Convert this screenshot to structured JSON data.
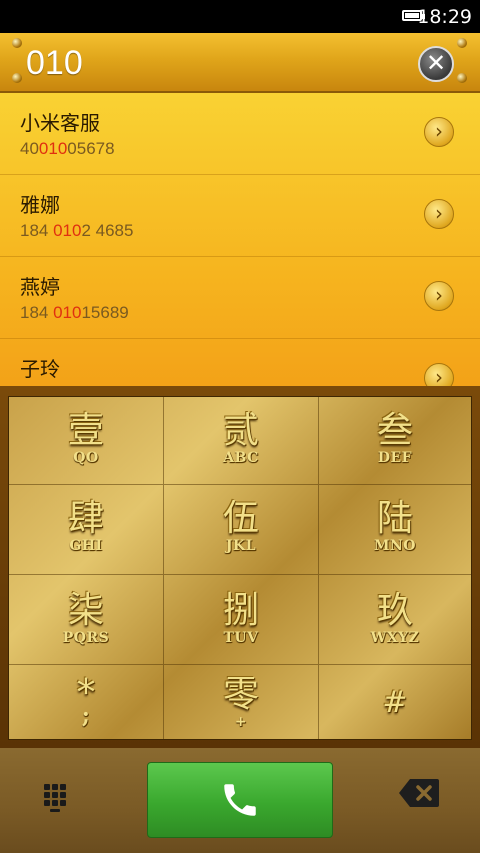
{
  "status_bar": {
    "time": "18:29",
    "battery_icon": "battery-icon"
  },
  "dial_input": {
    "digits": "010",
    "clear_icon": "clear-icon"
  },
  "contacts": [
    {
      "name": "小米客服",
      "number_pre": "40",
      "number_match": "010",
      "number_post": "05678"
    },
    {
      "name": "雅娜",
      "number_pre": "184 ",
      "number_match": "010",
      "number_post": "2 4685"
    },
    {
      "name": "燕婷",
      "number_pre": "184 ",
      "number_match": "010",
      "number_post": "15689"
    },
    {
      "name": "子玲",
      "number_pre": "",
      "number_match": "",
      "number_post": ""
    }
  ],
  "dialpad": {
    "keys": [
      {
        "main": "壹",
        "sub": "QO"
      },
      {
        "main": "贰",
        "sub": "ABC"
      },
      {
        "main": "叁",
        "sub": "DEF"
      },
      {
        "main": "肆",
        "sub": "GHI"
      },
      {
        "main": "伍",
        "sub": "JKL"
      },
      {
        "main": "陆",
        "sub": "MNO"
      },
      {
        "main": "柒",
        "sub": "PQRS"
      },
      {
        "main": "捌",
        "sub": "TUV"
      },
      {
        "main": "玖",
        "sub": "WXYZ"
      },
      {
        "main": "*",
        "sub": ";"
      },
      {
        "main": "零",
        "sub": "+"
      },
      {
        "main": "#",
        "sub": ""
      }
    ]
  },
  "bottom_bar": {
    "dialpad_toggle_icon": "dialpad-grid-icon",
    "call_icon": "phone-icon",
    "backspace_icon": "backspace-icon",
    "call_color": "#3aa82e"
  }
}
